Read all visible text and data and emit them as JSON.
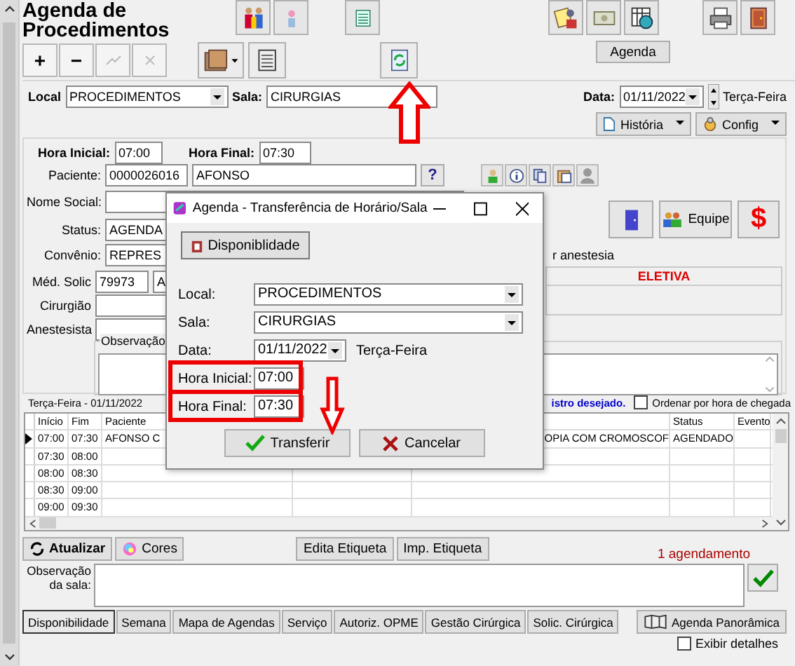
{
  "title": "Agenda de Procedimentos",
  "record_buttons": [
    {
      "kind": "text",
      "label": "+",
      "disabled": false
    },
    {
      "kind": "text",
      "label": "−",
      "disabled": false
    },
    {
      "kind": "edit",
      "disabled": true
    },
    {
      "kind": "cancel",
      "disabled": true
    }
  ],
  "agenda_button": "Agenda",
  "filter": {
    "local_label": "Local",
    "local": "PROCEDIMENTOS",
    "sala_label": "Sala:",
    "sala": "CIRURGIAS",
    "data_label": "Data:",
    "data": "01/11/2022",
    "weekday": "Terça-Feira"
  },
  "menu_buttons": [
    "História",
    "Config"
  ],
  "form": {
    "hora_inicial_label": "Hora Inicial:",
    "hora_inicial": "07:00",
    "hora_final_label": "Hora Final:",
    "hora_final": "07:30",
    "paciente_label": "Paciente:",
    "paciente_codigo": "0000026016",
    "paciente_nome": "AFONSO",
    "help": "?",
    "nome_social_label": "Nome Social:",
    "status_label": "Status:",
    "status": "AGENDA",
    "convenio_label": "Convênio:",
    "convenio": "REPRES",
    "equipe": "Equipe",
    "money": "$",
    "anestesia": "r anestesia",
    "tipo": "ELETIVA",
    "med_solic_label": "Méd. Solic",
    "med_solic_codigo": "79973",
    "med_solic_nome": "A",
    "cirurgiao_label": "Cirurgião",
    "anestesista_label": "Anestesista",
    "observacao_label": "Observação"
  },
  "info": {
    "date": "Terça-Feira - 01/11/2022",
    "hint": "istro desejado.",
    "order_checkbox": {
      "label": "Ordenar por hora de chegada",
      "checked": false
    }
  },
  "table": {
    "columns": [
      "Início",
      "Fim",
      "Paciente",
      null,
      null,
      "Status",
      "Evento"
    ],
    "rows": [
      {
        "selected": true,
        "cells": [
          "07:00",
          "07:30",
          "AFONSO C",
          null,
          "OPIA COM CROMOSCOF",
          "AGENDADO",
          null
        ]
      },
      {
        "selected": false,
        "cells": [
          "07:30",
          "08:00",
          null,
          null,
          null,
          null,
          null
        ]
      },
      {
        "selected": false,
        "cells": [
          "08:00",
          "08:30",
          null,
          null,
          null,
          null,
          null
        ]
      },
      {
        "selected": false,
        "cells": [
          "08:30",
          "09:00",
          null,
          null,
          null,
          null,
          null
        ]
      },
      {
        "selected": false,
        "cells": [
          "09:00",
          "09:30",
          null,
          null,
          null,
          null,
          null
        ]
      }
    ]
  },
  "actions": {
    "refresh": "Atualizar",
    "colors": "Cores",
    "label_buttons": [
      "Edita Etiqueta",
      "Imp. Etiqueta"
    ],
    "count": "1 agendamento"
  },
  "room_note": {
    "label": "Observação da sala:"
  },
  "tabs": [
    {
      "label": "Disponibilidade",
      "selected": true
    },
    {
      "label": "Semana",
      "selected": false
    },
    {
      "label": "Mapa de Agendas",
      "selected": false
    },
    {
      "label": "Serviço",
      "selected": false
    },
    {
      "label": "Autoriz. OPME",
      "selected": false
    },
    {
      "label": "Gestão Cirúrgica",
      "selected": false
    },
    {
      "label": "Solic. Cirúrgica",
      "selected": false
    }
  ],
  "panorama_button": "Agenda Panorâmica",
  "details_checkbox": {
    "label": "Exibir detalhes",
    "checked": false
  },
  "dialog": {
    "title": "Agenda - Transferência de Horário/Sala",
    "availability_button": "Disponiblidade",
    "local_label": "Local:",
    "local": "PROCEDIMENTOS",
    "sala_label": "Sala:",
    "sala": "CIRURGIAS",
    "data_label": "Data:",
    "data": "01/11/2022",
    "weekday": "Terça-Feira",
    "hora_inicial_label": "Hora Inicial:",
    "hora_inicial": "07:00",
    "hora_final_label": "Hora Final:",
    "hora_final": "07:30",
    "confirm_button": "Transferir",
    "cancel_button": "Cancelar"
  }
}
